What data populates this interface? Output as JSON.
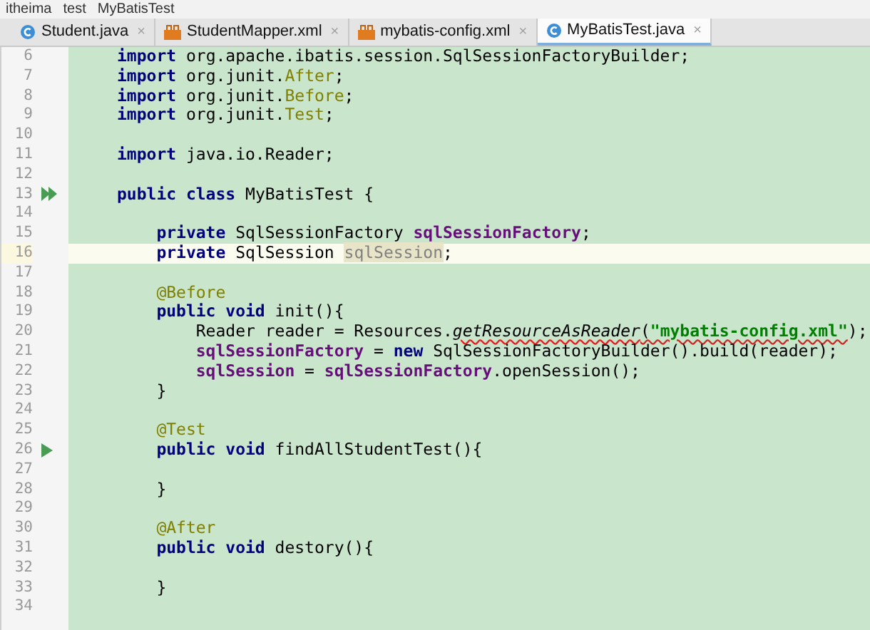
{
  "breadcrumb": [
    {
      "label": "itheima"
    },
    {
      "label": "test"
    },
    {
      "label": "MyBatisTest"
    }
  ],
  "tabs": [
    {
      "label": "Student.java",
      "kind": "java",
      "selected": false,
      "close": "×"
    },
    {
      "label": "StudentMapper.xml",
      "kind": "xml",
      "selected": false,
      "close": "×"
    },
    {
      "label": "mybatis-config.xml",
      "kind": "xml",
      "selected": false,
      "close": "×"
    },
    {
      "label": "MyBatisTest.java",
      "kind": "java",
      "selected": true,
      "close": "×"
    }
  ],
  "lines": [
    {
      "number": "6",
      "current": false,
      "tokens": [
        {
          "kind": "kw",
          "text": "import"
        },
        {
          "kind": "plain",
          "text": " org.apache.ibatis.session.SqlSessionFactoryBuilder;"
        }
      ]
    },
    {
      "number": "7",
      "current": false,
      "tokens": [
        {
          "kind": "kw",
          "text": "import"
        },
        {
          "kind": "plain",
          "text": " org.junit."
        },
        {
          "kind": "member",
          "text": "After"
        },
        {
          "kind": "plain",
          "text": ";"
        }
      ]
    },
    {
      "number": "8",
      "current": false,
      "tokens": [
        {
          "kind": "kw",
          "text": "import"
        },
        {
          "kind": "plain",
          "text": " org.junit."
        },
        {
          "kind": "member",
          "text": "Before"
        },
        {
          "kind": "plain",
          "text": ";"
        }
      ]
    },
    {
      "number": "9",
      "current": false,
      "tokens": [
        {
          "kind": "kw",
          "text": "import"
        },
        {
          "kind": "plain",
          "text": " org.junit."
        },
        {
          "kind": "member",
          "text": "Test"
        },
        {
          "kind": "plain",
          "text": ";"
        }
      ]
    },
    {
      "number": "10",
      "current": false
    },
    {
      "number": "11",
      "current": false,
      "tokens": [
        {
          "kind": "kw",
          "text": "import"
        },
        {
          "kind": "plain",
          "text": " java.io.Reader;"
        }
      ]
    },
    {
      "number": "12",
      "current": false
    },
    {
      "number": "13",
      "current": false,
      "kind": "run_all",
      "tokens": [
        {
          "kind": "kw",
          "text": "public class"
        },
        {
          "kind": "plain",
          "text": " MyBatisTest {"
        }
      ]
    },
    {
      "number": "14",
      "current": false
    },
    {
      "number": "15",
      "current": false,
      "tokens": [
        {
          "kind": "kw",
          "text": "    private"
        },
        {
          "kind": "plain",
          "text": " SqlSessionFactory "
        },
        {
          "kind": "field",
          "text": "sqlSessionFactory"
        },
        {
          "kind": "plain",
          "text": ";"
        }
      ]
    },
    {
      "number": "16",
      "current": true,
      "tokens": [
        {
          "kind": "kw",
          "text": "    private"
        },
        {
          "kind": "plain",
          "text": " SqlSession "
        },
        {
          "kind": "unused",
          "text": "sqlSession"
        },
        {
          "kind": "plain",
          "text": ";"
        }
      ]
    },
    {
      "number": "17",
      "current": false
    },
    {
      "number": "18",
      "current": false,
      "tokens": [
        {
          "kind": "ann",
          "text": "    @Before"
        }
      ]
    },
    {
      "number": "19",
      "current": false,
      "tokens": [
        {
          "kind": "kw",
          "text": "    public void"
        },
        {
          "kind": "plain",
          "text": " init(){"
        }
      ]
    },
    {
      "number": "20",
      "current": false,
      "tokens": [
        {
          "kind": "plain",
          "text": "        Reader reader = Resources."
        },
        {
          "kind": "italic",
          "text": "getResourceAsReader",
          "error": true
        },
        {
          "kind": "plain",
          "text": "(",
          "error": true
        },
        {
          "kind": "str",
          "text": "\"mybatis-config.xml\"",
          "error": true
        },
        {
          "kind": "plain",
          "text": ");"
        }
      ]
    },
    {
      "number": "21",
      "current": false,
      "tokens": [
        {
          "kind": "field",
          "text": "        sqlSessionFactory"
        },
        {
          "kind": "plain",
          "text": " = "
        },
        {
          "kind": "kw",
          "text": "new"
        },
        {
          "kind": "plain",
          "text": " SqlSessionFactoryBuilder().build(reader);"
        }
      ]
    },
    {
      "number": "22",
      "current": false,
      "tokens": [
        {
          "kind": "field",
          "text": "        sqlSession"
        },
        {
          "kind": "plain",
          "text": " = "
        },
        {
          "kind": "field",
          "text": "sqlSessionFactory"
        },
        {
          "kind": "plain",
          "text": ".openSession();"
        }
      ]
    },
    {
      "number": "23",
      "current": false,
      "tokens": [
        {
          "kind": "plain",
          "text": "    }"
        }
      ]
    },
    {
      "number": "24",
      "current": false
    },
    {
      "number": "25",
      "current": false,
      "tokens": [
        {
          "kind": "ann",
          "text": "    @Test"
        }
      ]
    },
    {
      "number": "26",
      "current": false,
      "kind": "run",
      "tokens": [
        {
          "kind": "kw",
          "text": "    public void"
        },
        {
          "kind": "plain",
          "text": " findAllStudentTest(){"
        }
      ]
    },
    {
      "number": "27",
      "current": false
    },
    {
      "number": "28",
      "current": false,
      "tokens": [
        {
          "kind": "plain",
          "text": "    }"
        }
      ]
    },
    {
      "number": "29",
      "current": false
    },
    {
      "number": "30",
      "current": false,
      "tokens": [
        {
          "kind": "ann",
          "text": "    @After"
        }
      ]
    },
    {
      "number": "31",
      "current": false,
      "tokens": [
        {
          "kind": "kw",
          "text": "    public void"
        },
        {
          "kind": "plain",
          "text": " destory(){"
        }
      ]
    },
    {
      "number": "32",
      "current": false
    },
    {
      "number": "33",
      "current": false,
      "tokens": [
        {
          "kind": "plain",
          "text": "    }"
        }
      ]
    },
    {
      "number": "34",
      "current": false
    }
  ]
}
